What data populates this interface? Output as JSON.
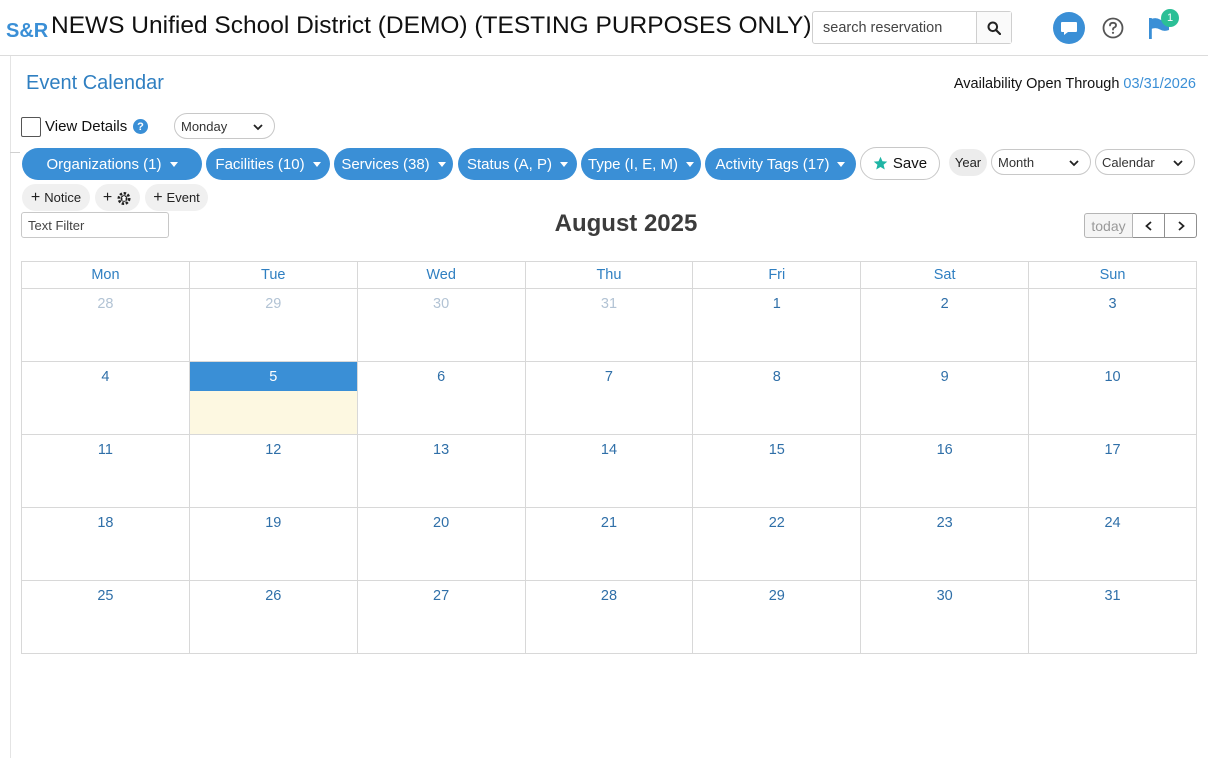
{
  "header": {
    "logo": "S&R",
    "site_title": "NEWS Unified School District (DEMO) (TESTING PURPOSES ONLY)",
    "search_placeholder": "search reservation",
    "flag_badge_count": "1"
  },
  "page": {
    "title": "Event Calendar",
    "availability_label": "Availability Open Through",
    "availability_date": "03/31/2026"
  },
  "controls": {
    "view_details_label": "View Details",
    "view_details_checked": false,
    "week_start_value": "Monday",
    "filters": [
      {
        "label": "Organizations (1)"
      },
      {
        "label": "Facilities (10)"
      },
      {
        "label": "Services (38)"
      },
      {
        "label": "Status (A, P)"
      },
      {
        "label": "Type (I, E, M)"
      },
      {
        "label": "Activity Tags (17)"
      }
    ],
    "save_label": "Save",
    "year_label": "Year",
    "view_select_value": "Month",
    "layout_select_value": "Calendar",
    "add_notice_label": "Notice",
    "add_event_label": "Event",
    "text_filter_placeholder": "Text Filter"
  },
  "calendar": {
    "month_title": "August 2025",
    "today_label": "today",
    "weekdays": [
      "Mon",
      "Tue",
      "Wed",
      "Thu",
      "Fri",
      "Sat",
      "Sun"
    ],
    "weeks": [
      [
        "28",
        "29",
        "30",
        "31",
        "1",
        "2",
        "3"
      ],
      [
        "4",
        "5",
        "6",
        "7",
        "8",
        "9",
        "10"
      ],
      [
        "11",
        "12",
        "13",
        "14",
        "15",
        "16",
        "17"
      ],
      [
        "18",
        "19",
        "20",
        "21",
        "22",
        "23",
        "24"
      ],
      [
        "25",
        "26",
        "27",
        "28",
        "29",
        "30",
        "31"
      ]
    ],
    "other_month_days": [
      [
        0,
        0
      ],
      [
        0,
        1
      ],
      [
        0,
        2
      ],
      [
        0,
        3
      ]
    ],
    "today_cell": [
      1,
      1
    ]
  },
  "colors": {
    "accent": "#3a8fd6",
    "title_blue": "#2f7fc1",
    "today_highlight": "#fdf8e1",
    "badge_green": "#2bbf96"
  }
}
